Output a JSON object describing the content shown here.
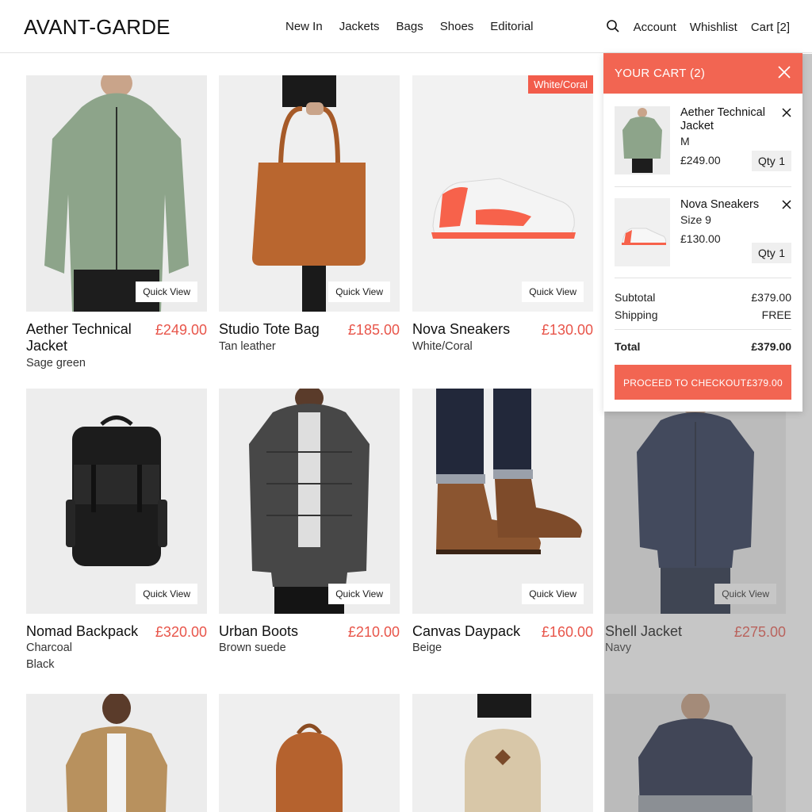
{
  "header": {
    "logo": "AVANT-GARDE",
    "nav": [
      "New In",
      "Jackets",
      "Bags",
      "Shoes",
      "Editorial"
    ],
    "account": "Account",
    "wishlist": "Whishlist",
    "cart": "Cart [2]"
  },
  "quick_view": "Quick View",
  "products": [
    {
      "name": "Aether Technical Jacket",
      "price": "£249.00",
      "sub1": "Sage green",
      "sub2": ""
    },
    {
      "name": "Studio Tote Bag",
      "price": "£185.00",
      "sub1": "Tan leather",
      "sub2": ""
    },
    {
      "name": "Nova Sneakers",
      "price": "£130.00",
      "sub1": "White/Coral",
      "sub2": "",
      "badge": "White/Coral"
    },
    {
      "name": "Nomad Backpack",
      "price": "£320.00",
      "sub1": "Charcoal",
      "sub2": "Black"
    },
    {
      "name": "Urban Boots",
      "price": "£210.00",
      "sub1": "Brown suede",
      "sub2": ""
    },
    {
      "name": "Canvas Daypack",
      "price": "£160.00",
      "sub1": "Beige",
      "sub2": ""
    },
    {
      "name": "Shell Jacket",
      "price": "£275.00",
      "sub1": "Navy",
      "sub2": ""
    }
  ],
  "cart_drawer": {
    "title": "YOUR CART (2)",
    "items": [
      {
        "name": "Aether Technical Jacket",
        "variant": "M",
        "price": "£249.00",
        "qty_label": "Qty",
        "qty": "1"
      },
      {
        "name": "Nova Sneakers",
        "variant": "Size 9",
        "price": "£130.00",
        "qty_label": "Qty",
        "qty": "1"
      }
    ],
    "subtotal_label": "Subtotal",
    "subtotal": "£379.00",
    "shipping_label": "Shipping",
    "shipping": "FREE",
    "total_label": "Total",
    "total": "£379.00",
    "checkout_label": "PROCEED TO CHECKOUT",
    "checkout_amount": "£379.00"
  },
  "colors": {
    "accent": "#f26552",
    "price": "#e8554a"
  }
}
